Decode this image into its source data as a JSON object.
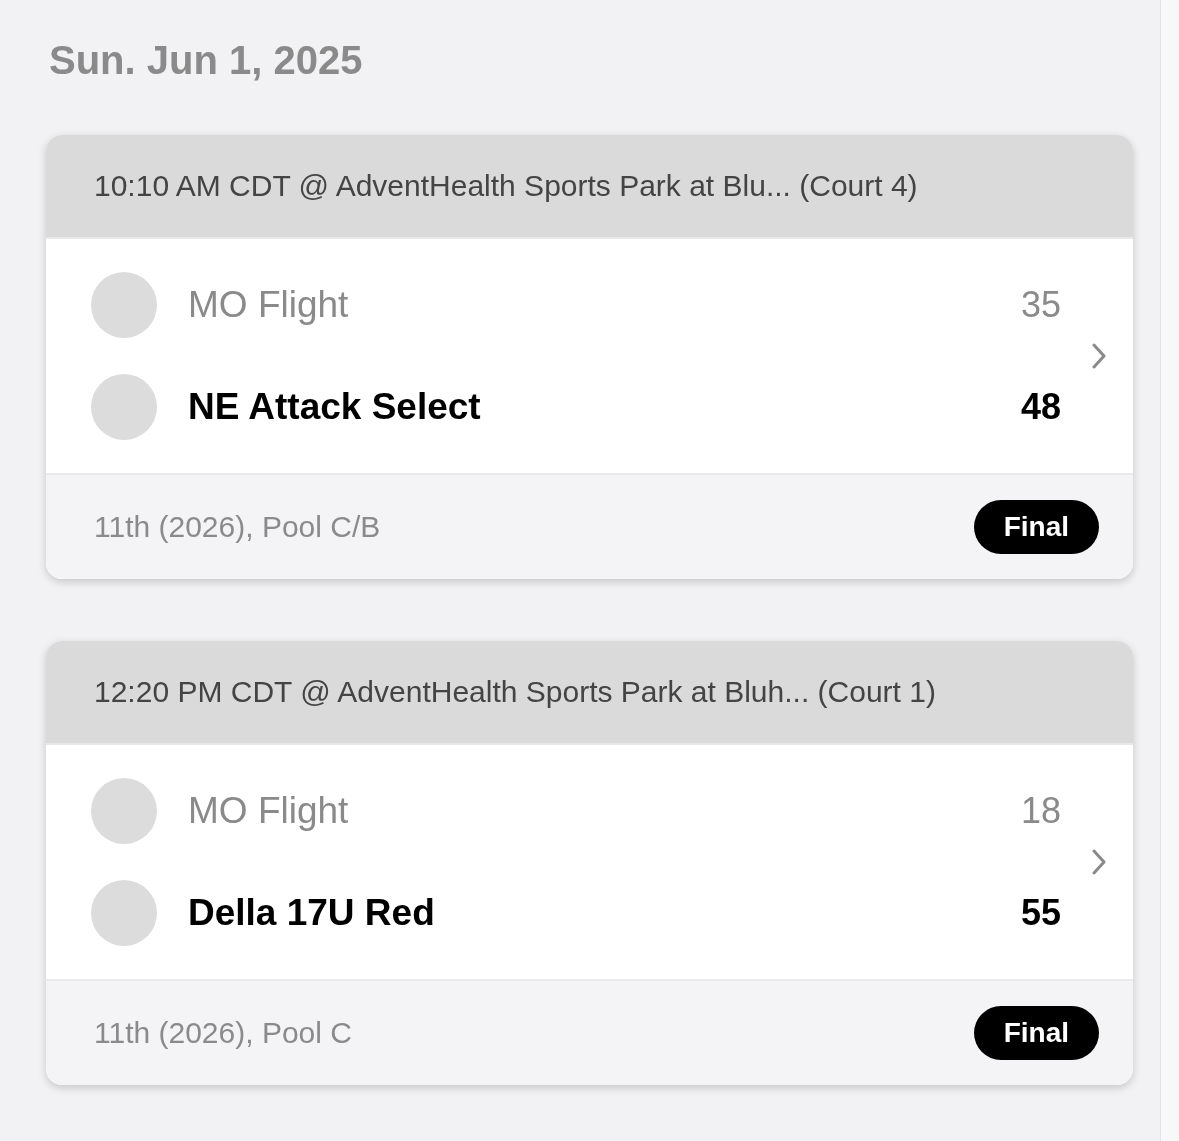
{
  "date": "Sun. Jun 1, 2025",
  "games": [
    {
      "header": "10:10 AM CDT @ AdventHealth Sports Park at Blu... (Court 4)",
      "teams": [
        {
          "name": "MO Flight",
          "score": "35",
          "winner": false
        },
        {
          "name": "NE Attack Select",
          "score": "48",
          "winner": true
        }
      ],
      "division": "11th (2026), Pool C/B",
      "status": "Final"
    },
    {
      "header": "12:20 PM CDT @ AdventHealth Sports Park at Bluh... (Court 1)",
      "teams": [
        {
          "name": "MO Flight",
          "score": "18",
          "winner": false
        },
        {
          "name": "Della 17U Red",
          "score": "55",
          "winner": true
        }
      ],
      "division": "11th (2026), Pool C",
      "status": "Final"
    }
  ]
}
